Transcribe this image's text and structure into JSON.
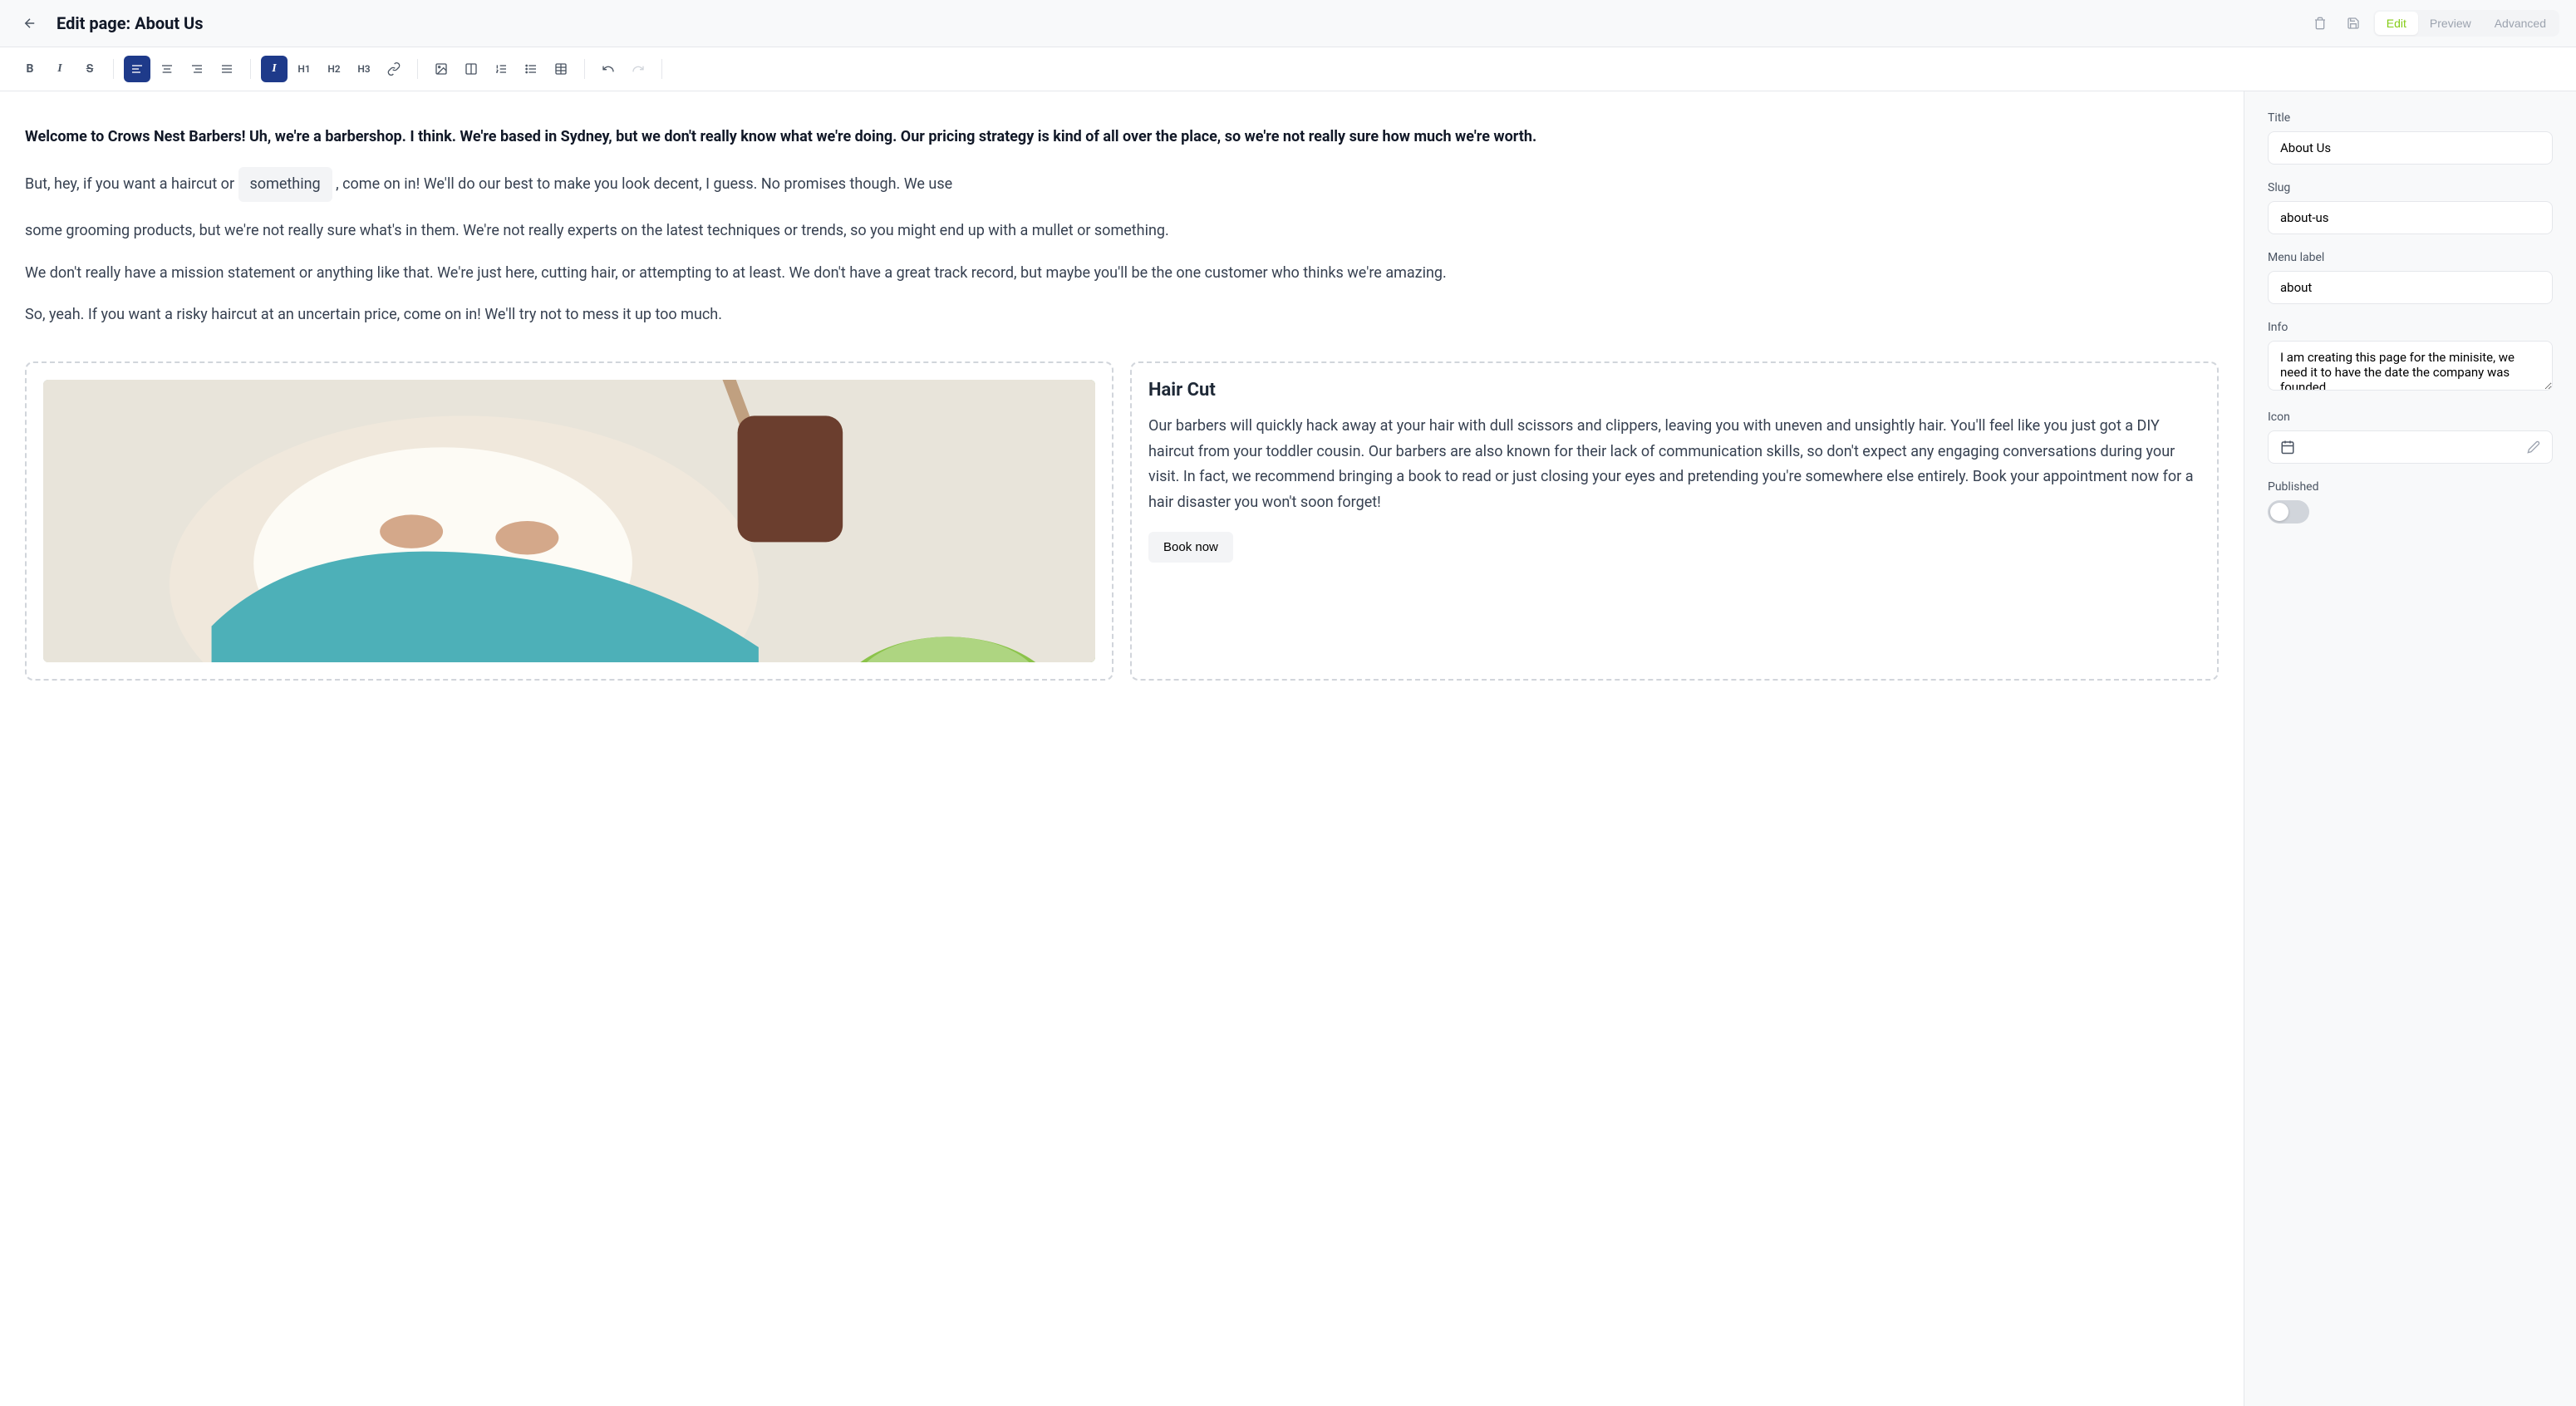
{
  "header": {
    "title": "Edit page: About Us",
    "tabs": {
      "edit": "Edit",
      "preview": "Preview",
      "advanced": "Advanced"
    }
  },
  "toolbar": {
    "h1": "H1",
    "h2": "H2",
    "h3": "H3"
  },
  "content": {
    "para1": "Welcome to Crows Nest Barbers! Uh, we're a barbershop. I think. We're based in Sydney, but we don't really know what we're doing. Our pricing strategy is kind of all over the place, so we're not really sure how much we're worth.",
    "para2_a": "But, hey, if you want a haircut or ",
    "para2_highlight": "something",
    "para2_b": " , come on in! We'll do our best to make you look decent, I guess. No promises though. We use",
    "para3": "some grooming products, but we're not really sure what's in them. We're not really experts on the latest techniques or trends, so you might end up with a mullet or something.",
    "para4": "We don't really have a mission statement or anything like that. We're just here, cutting hair, or attempting to at least. We don't have a great track record, but maybe you'll be the one customer who thinks we're amazing.",
    "para5": "So, yeah. If you want a risky haircut at an uncertain price, come on in! We'll try not to mess it up too much."
  },
  "card": {
    "title": "Hair Cut",
    "desc": "Our barbers will quickly hack away at your hair with dull scissors and clippers, leaving you with uneven and unsightly hair. You'll feel like you just got a DIY haircut from your toddler cousin. Our barbers are also known for their lack of communication skills, so don't expect any engaging conversations during your visit. In fact, we recommend bringing a book to read or just closing your eyes and pretending you're somewhere else entirely. Book your appointment now for a hair disaster you won't soon forget!",
    "cta": "Book now"
  },
  "sidebar": {
    "title_label": "Title",
    "title_value": "About Us",
    "slug_label": "Slug",
    "slug_value": "about-us",
    "menu_label": "Menu label",
    "menu_value": "about",
    "info_label": "Info",
    "info_value": "I am creating this page for the minisite, we need it to have the date the company was founded.",
    "icon_label": "Icon",
    "published_label": "Published"
  }
}
